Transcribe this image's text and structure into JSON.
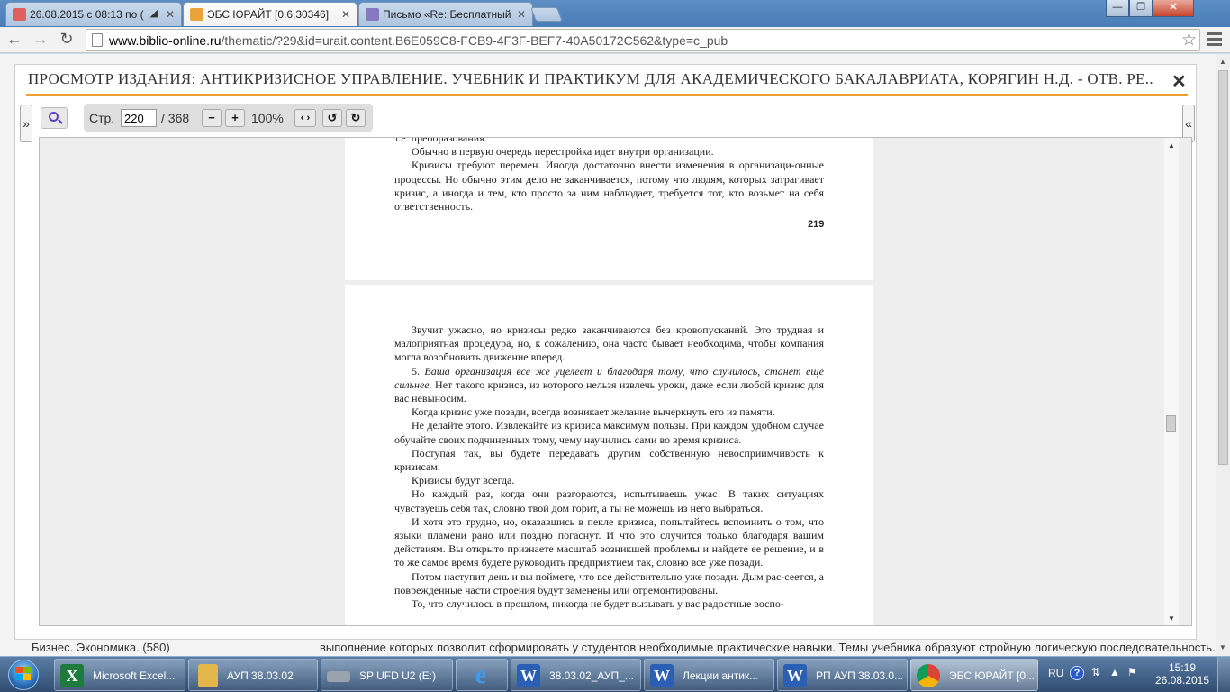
{
  "browser": {
    "tabs": [
      {
        "title": "26.08.2015 с 08:13 по (",
        "favicon_color": "#d44"
      },
      {
        "title": "ЭБС ЮРАЙТ [0.6.30346]",
        "favicon_color": "#e8a33a"
      },
      {
        "title": "Письмо «Re: Бесплатный",
        "favicon_color": "#7b6fb5"
      }
    ],
    "url_host": "www.biblio-online.ru",
    "url_path": "/thematic/?29&id=urait.content.B6E059C8-FCB9-4F3F-BEF7-40A50172C562&type=c_pub",
    "window_buttons": {
      "minimize": "—",
      "restore": "❐",
      "close": "✕"
    }
  },
  "background": {
    "left_text": "Бизнес. Экономика. (580)",
    "right_text": "выполнение которых позволит сформировать у студентов необходимые практические навыки. Темы учебника образуют стройную логическую последовательность. В"
  },
  "modal": {
    "title": "ПРОСМОТР ИЗДАНИЯ: АНТИКРИЗИСНОЕ УПРАВЛЕНИЕ. УЧЕБНИК И ПРАКТИКУМ ДЛЯ АКАДЕМИЧЕСКОГО БАКАЛАВРИАТА, КОРЯГИН Н.Д. - ОТВ. РЕ...",
    "close": "✕",
    "left_toggle": "»",
    "right_toggle": "«",
    "toolbar": {
      "page_label": "Стр.",
      "page_value": "220",
      "total_pages": "/ 368",
      "zoom_out": "−",
      "zoom_in": "+",
      "zoom": "100%",
      "fit": "‹ ›",
      "rotate_left": "↺",
      "rotate_right": "↻"
    }
  },
  "document": {
    "page1": {
      "lines": [
        "т.е. преобразования.",
        "Обычно в первую очередь перестройка идет внутри организации.",
        "Кризисы требуют перемен. Иногда достаточно внести изменения в организаци-онные процессы. Но обычно этим дело не заканчивается, потому что людям, которых затрагивает кризис, а иногда и тем, кто просто за ним наблюдает, требуется тот, кто возьмет на себя ответственность."
      ],
      "page_number": "219"
    },
    "page2": {
      "p1": "Звучит ужасно, но кризисы редко заканчиваются без кровопусканий. Это трудная и малоприятная процедура, но, к сожалению, она часто бывает необходима, чтобы компания могла возобновить движение вперед.",
      "p2_num": "5. ",
      "p2_italic": "Ваша организация все же уцелеет и благодаря тому, что случилось, станет еще сильнее.",
      "p2_rest": " Нет такого кризиса, из которого нельзя извлечь уроки, даже если любой кризис для вас невыносим.",
      "p3": "Когда кризис уже позади, всегда возникает желание вычеркнуть его из памяти.",
      "p4": "Не делайте этого. Извлекайте из кризиса максимум пользы. При каждом удобном случае обучайте своих подчиненных тому, чему научились сами во время кризиса.",
      "p5": "Поступая так, вы будете передавать другим собственную невосприимчивость к кризисам.",
      "p6": "Кризисы будут всегда.",
      "p7": "Но каждый раз, когда они разгораются, испытываешь ужас! В таких ситуациях чувствуешь себя так, словно твой дом горит, а ты не можешь из него выбраться.",
      "p8": "И хотя это трудно, но, оказавшись в пекле кризиса, попытайтесь вспомнить о том, что языки пламени рано или поздно погаснут. И что это случится только благодаря вашим действиям. Вы открыто признаете масштаб возникшей проблемы и найдете ее решение, и в то же самое время будете руководить предприятием так, словно все уже позади.",
      "p9": "Потом наступит день и вы поймете, что все действительно уже позади. Дым рас-сеется, а поврежденные части строения будут заменены или отремонтированы.",
      "p10": "То, что случилось в прошлом, никогда не будет вызывать у вас радостные воспо-"
    }
  },
  "taskbar": {
    "items": [
      {
        "label": "Microsoft Excel...",
        "icon": "excel-icon",
        "icon_text": "X",
        "color": "#1f7a3e"
      },
      {
        "label": "АУП 38.03.02",
        "icon": "folder-icon",
        "icon_text": "",
        "color": "#e2b64a"
      },
      {
        "label": "SP UFD U2 (E:)",
        "icon": "usb-drive-icon",
        "icon_text": "",
        "color": "#9aa3ad"
      },
      {
        "label": "",
        "icon": "internet-explorer-icon",
        "icon_text": "e",
        "color": "#2a7fd4"
      },
      {
        "label": "38.03.02_АУП_...",
        "icon": "word-icon",
        "icon_text": "W",
        "color": "#2b5fb4"
      },
      {
        "label": "Лекции антик...",
        "icon": "word-icon",
        "icon_text": "W",
        "color": "#2b5fb4"
      },
      {
        "label": "РП АУП 38.03.0...",
        "icon": "word-icon",
        "icon_text": "W",
        "color": "#2b5fb4"
      },
      {
        "label": "ЭБС ЮРАЙТ [0...",
        "icon": "chrome-icon",
        "icon_text": "",
        "color": "#4a8a3a"
      }
    ],
    "language": "RU",
    "help": "?",
    "time": "15:19",
    "date": "26.08.2015"
  }
}
